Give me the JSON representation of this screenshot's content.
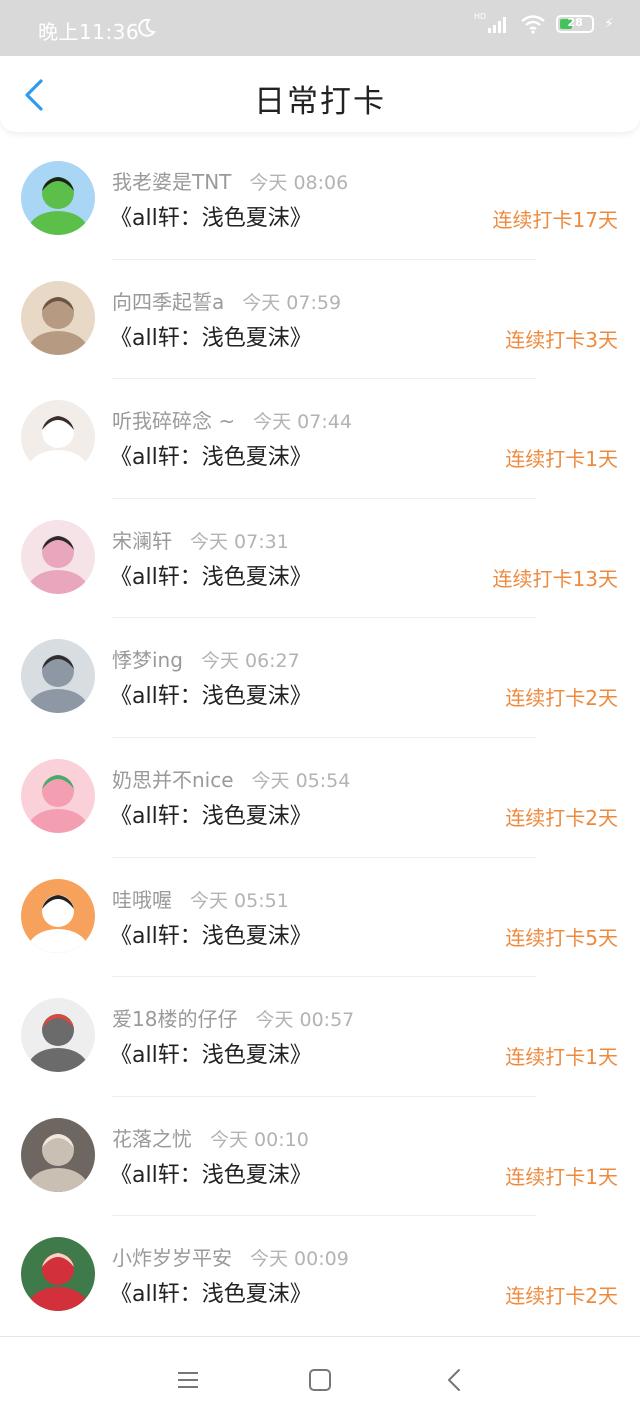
{
  "status": {
    "time": "晚上11:36",
    "hd": "HD",
    "battery": "28"
  },
  "header": {
    "title": "日常打卡"
  },
  "checkins": [
    {
      "name": "我老婆是TNT",
      "time": "今天 08:06",
      "book": "《all轩：浅色夏沫》",
      "streak": "连续打卡17天",
      "avatar_colors": [
        "#a9d6f5",
        "#5bbf4a",
        "#1e1e1e"
      ]
    },
    {
      "name": "向四季起誓a",
      "time": "今天 07:59",
      "book": "《all轩：浅色夏沫》",
      "streak": "连续打卡3天",
      "avatar_colors": [
        "#e8d9c7",
        "#b79a82",
        "#6a5545"
      ]
    },
    {
      "name": "听我碎碎念 ~",
      "time": "今天 07:44",
      "book": "《all轩：浅色夏沫》",
      "streak": "连续打卡1天",
      "avatar_colors": [
        "#f2ede9",
        "#ffffff",
        "#3b2f2b"
      ]
    },
    {
      "name": "宋澜轩",
      "time": "今天 07:31",
      "book": "《all轩：浅色夏沫》",
      "streak": "连续打卡13天",
      "avatar_colors": [
        "#f5e3e8",
        "#e9a7bd",
        "#2a2a2a"
      ]
    },
    {
      "name": "悸梦ing",
      "time": "今天 06:27",
      "book": "《all轩：浅色夏沫》",
      "streak": "连续打卡2天",
      "avatar_colors": [
        "#d8dde2",
        "#8e98a4",
        "#2e2e2e"
      ]
    },
    {
      "name": "奶思并不nice",
      "time": "今天 05:54",
      "book": "《all轩：浅色夏沫》",
      "streak": "连续打卡2天",
      "avatar_colors": [
        "#fbd1d9",
        "#f39fb1",
        "#3fae6a"
      ]
    },
    {
      "name": "哇哦喔",
      "time": "今天 05:51",
      "book": "《all轩：浅色夏沫》",
      "streak": "连续打卡5天",
      "avatar_colors": [
        "#f7a25c",
        "#ffffff",
        "#222222"
      ]
    },
    {
      "name": "爱18楼的仔仔",
      "time": "今天 00:57",
      "book": "《all轩：浅色夏沫》",
      "streak": "连续打卡1天",
      "avatar_colors": [
        "#eeeeee",
        "#6b6b6b",
        "#e0463c"
      ]
    },
    {
      "name": "花落之忧",
      "time": "今天 00:10",
      "book": "《all轩：浅色夏沫》",
      "streak": "连续打卡1天",
      "avatar_colors": [
        "#6e6660",
        "#c9bfb2",
        "#efe9df"
      ]
    },
    {
      "name": "小炸岁岁平安",
      "time": "今天 00:09",
      "book": "《all轩：浅色夏沫》",
      "streak": "连续打卡2天",
      "avatar_colors": [
        "#3e7a4a",
        "#d2303a",
        "#f3d6c8"
      ]
    }
  ],
  "colors": {
    "accent": "#ee8a3e",
    "back_arrow": "#2f9bef",
    "status_bar": "#d9d9d9"
  },
  "icons": {
    "back": "chevron-left-icon",
    "menu": "menu-icon",
    "home": "home-square-icon",
    "nav_back": "nav-back-icon"
  }
}
